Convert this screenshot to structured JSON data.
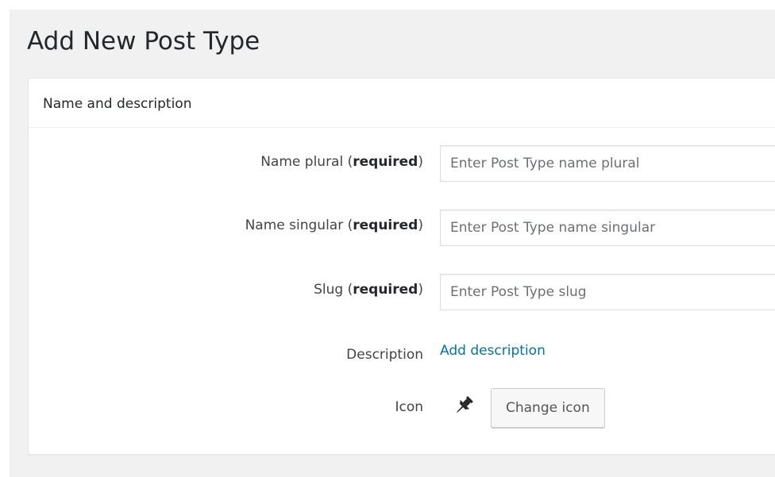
{
  "page": {
    "title": "Add New Post Type"
  },
  "postbox": {
    "title": "Name and description",
    "required_text": "required",
    "fields": {
      "name_plural": {
        "label": "Name plural",
        "placeholder": "Enter Post Type name plural",
        "value": ""
      },
      "name_singular": {
        "label": "Name singular",
        "placeholder": "Enter Post Type name singular",
        "value": ""
      },
      "slug": {
        "label": "Slug",
        "placeholder": "Enter Post Type slug",
        "value": ""
      }
    },
    "description": {
      "label": "Description",
      "link_text": "Add description"
    },
    "icon": {
      "label": "Icon",
      "current_icon": "pushpin-icon",
      "button_label": "Change icon"
    }
  },
  "colors": {
    "link": "#0073aa",
    "background": "#f1f1f1",
    "panel": "#ffffff"
  }
}
